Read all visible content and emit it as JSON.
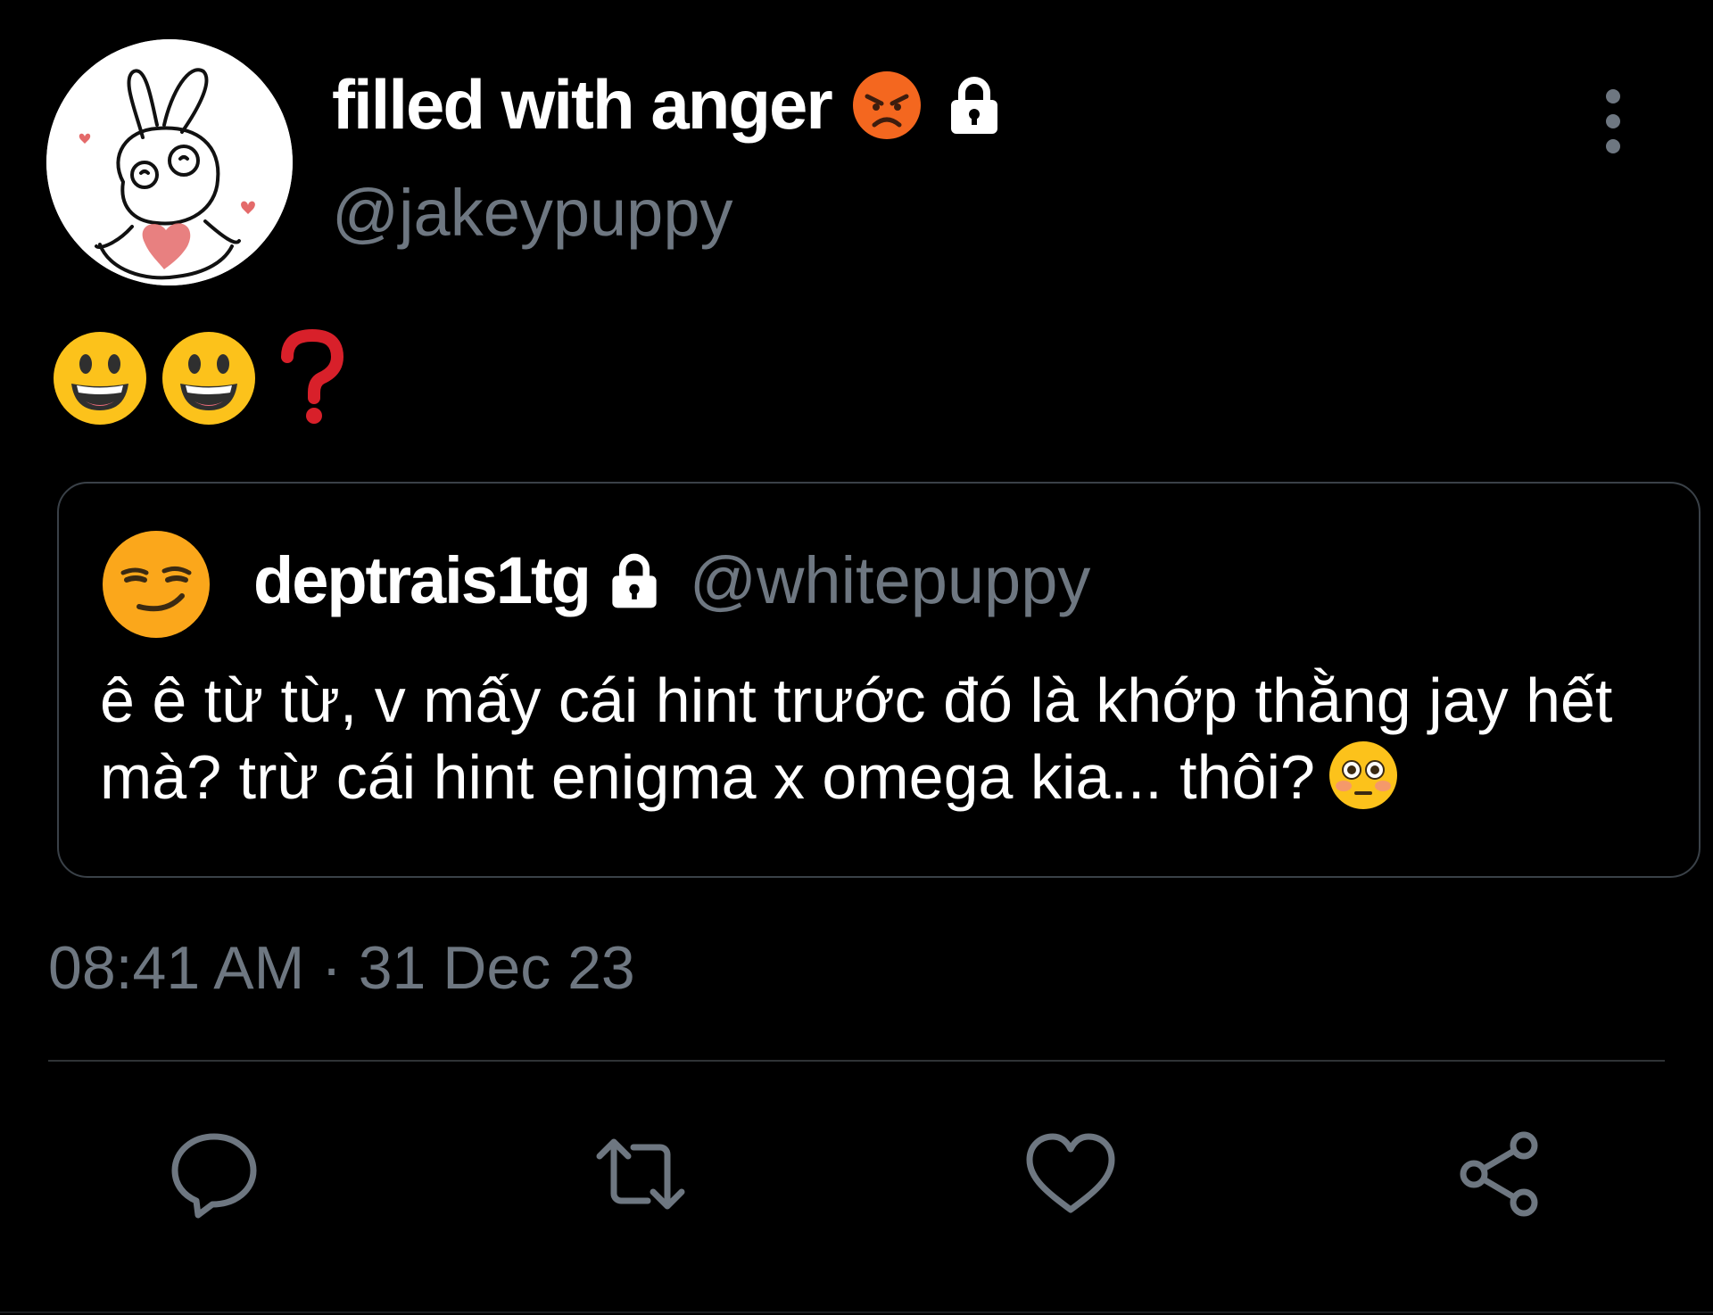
{
  "author": {
    "display_name": "filled with anger",
    "handle": "@jakeypuppy",
    "status_emoji": "angry-face-icon",
    "protected_icon": "lock-icon"
  },
  "tweet": {
    "emojis": [
      "grinning-face-icon",
      "grinning-face-icon",
      "red-question-mark-icon"
    ]
  },
  "quoted_tweet": {
    "display_name": "deptrais1tg",
    "handle": "@whitepuppy",
    "avatar_icon": "smirking-face-icon",
    "text": "ê ê từ từ, v mấy cái hint trước đó là khớp thằng jay hết mà? trừ cái hint enigma x omega kia... thôi?",
    "trailing_emoji": "flushed-face-icon"
  },
  "timestamp": "08:41 AM · 31 Dec 23",
  "actions": [
    "reply-icon",
    "retweet-icon",
    "like-icon",
    "share-icon"
  ],
  "colors": {
    "background": "#000000",
    "text": "#ffffff",
    "secondary_text": "#6e7781",
    "border": "#3a4148"
  }
}
